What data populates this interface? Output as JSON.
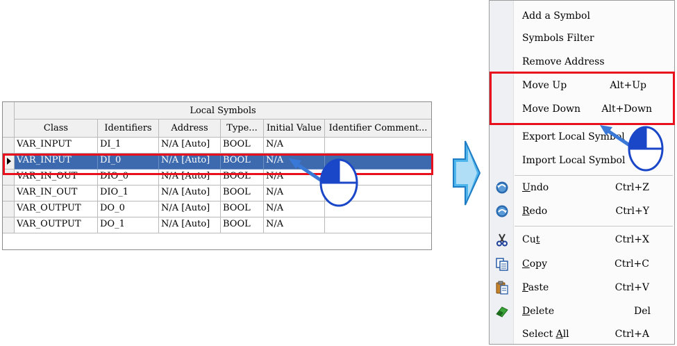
{
  "grid": {
    "title": "Local Symbols",
    "columns": [
      "Class",
      "Identifiers",
      "Address",
      "Type...",
      "Initial Value",
      "Identifier Comment..."
    ],
    "rows": [
      [
        "VAR_INPUT",
        "DI_1",
        "N/A [Auto]",
        "BOOL",
        "N/A",
        ""
      ],
      [
        "VAR_INPUT",
        "DI_0",
        "N/A [Auto]",
        "BOOL",
        "N/A",
        ""
      ],
      [
        "VAR_IN_OUT",
        "DIO_0",
        "N/A [Auto]",
        "BOOL",
        "N/A",
        ""
      ],
      [
        "VAR_IN_OUT",
        "DIO_1",
        "N/A [Auto]",
        "BOOL",
        "N/A",
        ""
      ],
      [
        "VAR_OUTPUT",
        "DO_0",
        "N/A [Auto]",
        "BOOL",
        "N/A",
        ""
      ],
      [
        "VAR_OUTPUT",
        "DO_1",
        "N/A [Auto]",
        "BOOL",
        "N/A",
        ""
      ]
    ],
    "selected_row": 1
  },
  "menu": {
    "items": [
      {
        "label": "Add a Symbol",
        "shortcut": "",
        "icon": ""
      },
      {
        "label": "Symbols Filter",
        "shortcut": "",
        "icon": ""
      },
      {
        "label": "Remove Address",
        "shortcut": "",
        "icon": ""
      },
      {
        "label": "Move Up",
        "shortcut": "Alt+Up",
        "icon": ""
      },
      {
        "label": "Move Down",
        "shortcut": "Alt+Down",
        "icon": ""
      },
      {
        "label": "Export Local Symbol",
        "shortcut": "",
        "icon": ""
      },
      {
        "label": "Import Local Symbol",
        "shortcut": "",
        "icon": ""
      },
      {
        "label_pre": "",
        "label_u": "U",
        "label_post": "ndo",
        "shortcut": "Ctrl+Z",
        "icon": "undo-icon"
      },
      {
        "label_pre": "",
        "label_u": "R",
        "label_post": "edo",
        "shortcut": "Ctrl+Y",
        "icon": "redo-icon"
      },
      {
        "label_pre": "Cu",
        "label_u": "t",
        "label_post": "",
        "shortcut": "Ctrl+X",
        "icon": "cut-icon"
      },
      {
        "label_pre": "",
        "label_u": "C",
        "label_post": "opy",
        "shortcut": "Ctrl+C",
        "icon": "copy-icon"
      },
      {
        "label_pre": "",
        "label_u": "P",
        "label_post": "aste",
        "shortcut": "Ctrl+V",
        "icon": "paste-icon"
      },
      {
        "label_pre": "",
        "label_u": "D",
        "label_post": "elete",
        "shortcut": "Del",
        "icon": "eraser-icon"
      },
      {
        "label_pre": "Select ",
        "label_u": "A",
        "label_post": "ll",
        "shortcut": "Ctrl+A",
        "icon": ""
      }
    ]
  },
  "colors": {
    "selection": "#3d6aae",
    "highlight_box": "#e8101c",
    "arrow_fill": "#4fb6ec",
    "pointer": "#3a78d8"
  }
}
